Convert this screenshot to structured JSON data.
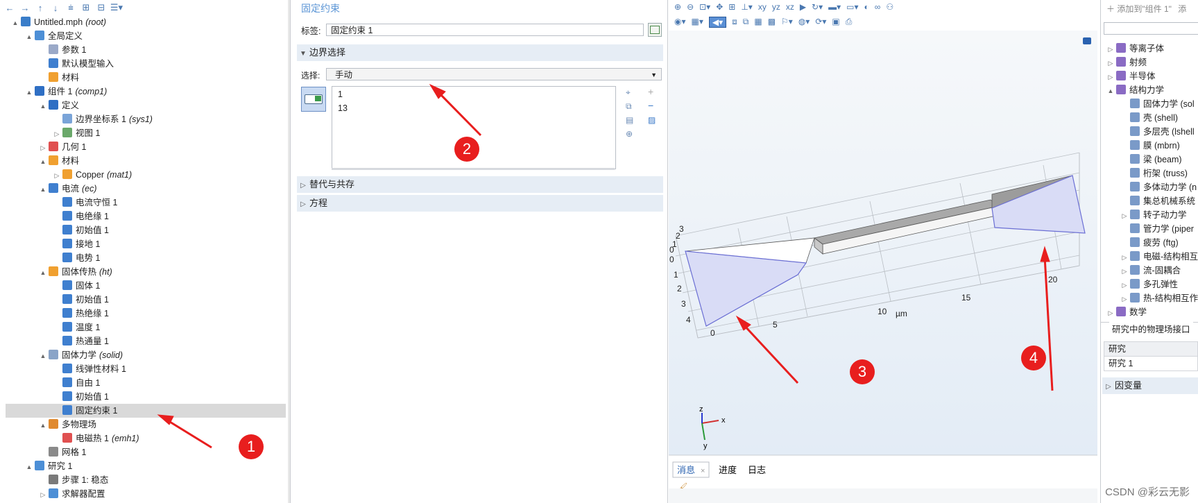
{
  "tree_toolbar": {
    "icons": [
      "back-arrow-icon",
      "forward-arrow-icon",
      "move-up-icon",
      "move-down-icon",
      "show-icon",
      "expand-icon",
      "collapse-icon",
      "list-menu-icon"
    ]
  },
  "tree": {
    "items": [
      {
        "label": "Untitled.mph",
        "tag": "(root)",
        "depth": 0,
        "toggle": "▲",
        "icon": "model-icon",
        "color": "#3a7dc9"
      },
      {
        "label": "全局定义",
        "tag": "",
        "depth": 1,
        "toggle": "▲",
        "icon": "globe-icon",
        "color": "#4d8fd6"
      },
      {
        "label": "参数 1",
        "tag": "",
        "depth": 2,
        "toggle": "",
        "icon": "parameter-icon",
        "color": "#9aa9c8"
      },
      {
        "label": "默认模型输入",
        "tag": "",
        "depth": 2,
        "toggle": "",
        "icon": "model-input-icon",
        "color": "#3f7fcf"
      },
      {
        "label": "材料",
        "tag": "",
        "depth": 2,
        "toggle": "",
        "icon": "material-icon",
        "color": "#f0a030"
      },
      {
        "label": "组件 1",
        "tag": "(comp1)",
        "depth": 1,
        "toggle": "▲",
        "icon": "component-icon",
        "color": "#2f6fc4"
      },
      {
        "label": "定义",
        "tag": "",
        "depth": 2,
        "toggle": "▲",
        "icon": "definitions-icon",
        "color": "#2f6fc4"
      },
      {
        "label": "边界坐标系 1",
        "tag": "(sys1)",
        "depth": 3,
        "toggle": "",
        "icon": "coordinate-system-icon",
        "color": "#7aa4d8"
      },
      {
        "label": "视图 1",
        "tag": "",
        "depth": 3,
        "toggle": "▷",
        "icon": "view-icon",
        "color": "#6aa86a"
      },
      {
        "label": "几何 1",
        "tag": "",
        "depth": 2,
        "toggle": "▷",
        "icon": "geometry-icon",
        "color": "#e05050"
      },
      {
        "label": "材料",
        "tag": "",
        "depth": 2,
        "toggle": "▲",
        "icon": "material-icon",
        "color": "#f0a030"
      },
      {
        "label": "Copper",
        "tag": "(mat1)",
        "depth": 3,
        "toggle": "▷",
        "icon": "material-icon",
        "color": "#f0a030"
      },
      {
        "label": "电流",
        "tag": "(ec)",
        "depth": 2,
        "toggle": "▲",
        "icon": "electric-currents-icon",
        "color": "#3f7fcf"
      },
      {
        "label": "电流守恒 1",
        "tag": "",
        "depth": 3,
        "toggle": "",
        "icon": "node-icon",
        "color": "#3f7fcf"
      },
      {
        "label": "电绝缘 1",
        "tag": "",
        "depth": 3,
        "toggle": "",
        "icon": "node-icon",
        "color": "#3f7fcf"
      },
      {
        "label": "初始值 1",
        "tag": "",
        "depth": 3,
        "toggle": "",
        "icon": "node-icon",
        "color": "#3f7fcf"
      },
      {
        "label": "接地 1",
        "tag": "",
        "depth": 3,
        "toggle": "",
        "icon": "node-icon",
        "color": "#3f7fcf"
      },
      {
        "label": "电势 1",
        "tag": "",
        "depth": 3,
        "toggle": "",
        "icon": "node-icon",
        "color": "#3f7fcf"
      },
      {
        "label": "固体传热",
        "tag": "(ht)",
        "depth": 2,
        "toggle": "▲",
        "icon": "heat-transfer-icon",
        "color": "#f0a030"
      },
      {
        "label": "固体 1",
        "tag": "",
        "depth": 3,
        "toggle": "",
        "icon": "node-icon",
        "color": "#3f7fcf"
      },
      {
        "label": "初始值 1",
        "tag": "",
        "depth": 3,
        "toggle": "",
        "icon": "node-icon",
        "color": "#3f7fcf"
      },
      {
        "label": "热绝缘 1",
        "tag": "",
        "depth": 3,
        "toggle": "",
        "icon": "node-icon",
        "color": "#3f7fcf"
      },
      {
        "label": "温度 1",
        "tag": "",
        "depth": 3,
        "toggle": "",
        "icon": "node-icon",
        "color": "#3f7fcf"
      },
      {
        "label": "热通量 1",
        "tag": "",
        "depth": 3,
        "toggle": "",
        "icon": "node-icon",
        "color": "#3f7fcf"
      },
      {
        "label": "固体力学",
        "tag": "(solid)",
        "depth": 2,
        "toggle": "▲",
        "icon": "solid-mechanics-icon",
        "color": "#8aa4c8"
      },
      {
        "label": "线弹性材料 1",
        "tag": "",
        "depth": 3,
        "toggle": "",
        "icon": "node-icon",
        "color": "#3f7fcf"
      },
      {
        "label": "自由 1",
        "tag": "",
        "depth": 3,
        "toggle": "",
        "icon": "node-icon",
        "color": "#3f7fcf"
      },
      {
        "label": "初始值 1",
        "tag": "",
        "depth": 3,
        "toggle": "",
        "icon": "node-icon",
        "color": "#3f7fcf"
      },
      {
        "label": "固定约束 1",
        "tag": "",
        "depth": 3,
        "toggle": "",
        "icon": "node-icon",
        "color": "#3f7fcf",
        "selected": true
      },
      {
        "label": "多物理场",
        "tag": "",
        "depth": 2,
        "toggle": "▲",
        "icon": "multiphysics-icon",
        "color": "#e08a30"
      },
      {
        "label": "电磁热 1",
        "tag": "(emh1)",
        "depth": 3,
        "toggle": "",
        "icon": "multiphysics-coupling-icon",
        "color": "#e05050"
      },
      {
        "label": "网格 1",
        "tag": "",
        "depth": 2,
        "toggle": "",
        "icon": "mesh-icon",
        "color": "#8a8a8a"
      },
      {
        "label": "研究 1",
        "tag": "",
        "depth": 1,
        "toggle": "▲",
        "icon": "study-icon",
        "color": "#4d8fd6"
      },
      {
        "label": "步骤 1: 稳态",
        "tag": "",
        "depth": 2,
        "toggle": "",
        "icon": "study-step-icon",
        "color": "#7a7a7a"
      },
      {
        "label": "求解器配置",
        "tag": "",
        "depth": 2,
        "toggle": "▷",
        "icon": "solver-icon",
        "color": "#4d8fd6"
      }
    ]
  },
  "settings": {
    "title": "固定约束",
    "label_caption": "标签:",
    "label_value": "固定约束 1",
    "boundary_section": "边界选择",
    "selection_caption": "选择:",
    "selection_value": "手动",
    "selection_items": [
      "1",
      "13"
    ],
    "override_section": "替代与共存",
    "equation_section": "方程"
  },
  "graphics": {
    "axis_unit": "µm",
    "x_ticks": [
      "5",
      "10",
      "15",
      "20"
    ],
    "left_ticks": [
      "3",
      "2",
      "1",
      "0",
      "0",
      "1",
      "2",
      "3",
      "4",
      "0"
    ],
    "triad": {
      "x": "x",
      "y": "y",
      "z": "z"
    },
    "highlight_color": "#d9dcf6"
  },
  "messages": {
    "tabs": [
      "消息",
      "进度",
      "日志"
    ]
  },
  "right_panel": {
    "add_to": "添加到\"组件 1\"",
    "add_more": "添",
    "physics": [
      {
        "label": "等离子体",
        "depth": 0,
        "toggle": "▷"
      },
      {
        "label": "射频",
        "depth": 0,
        "toggle": "▷"
      },
      {
        "label": "半导体",
        "depth": 0,
        "toggle": "▷"
      },
      {
        "label": "结构力学",
        "depth": 0,
        "toggle": "▲"
      },
      {
        "label": "固体力学 (sol",
        "depth": 1,
        "toggle": ""
      },
      {
        "label": "壳 (shell)",
        "depth": 1,
        "toggle": ""
      },
      {
        "label": "多层壳 (lshell",
        "depth": 1,
        "toggle": ""
      },
      {
        "label": "膜 (mbrn)",
        "depth": 1,
        "toggle": ""
      },
      {
        "label": "梁 (beam)",
        "depth": 1,
        "toggle": ""
      },
      {
        "label": "桁架 (truss)",
        "depth": 1,
        "toggle": ""
      },
      {
        "label": "多体动力学 (n",
        "depth": 1,
        "toggle": ""
      },
      {
        "label": "集总机械系统",
        "depth": 1,
        "toggle": ""
      },
      {
        "label": "转子动力学",
        "depth": 1,
        "toggle": "▷"
      },
      {
        "label": "管力学 (piper",
        "depth": 1,
        "toggle": ""
      },
      {
        "label": "疲劳 (ftg)",
        "depth": 1,
        "toggle": ""
      },
      {
        "label": "电磁-结构相互",
        "depth": 1,
        "toggle": "▷"
      },
      {
        "label": "流-固耦合",
        "depth": 1,
        "toggle": "▷"
      },
      {
        "label": "多孔弹性",
        "depth": 1,
        "toggle": "▷"
      },
      {
        "label": "热-结构相互作",
        "depth": 1,
        "toggle": "▷"
      },
      {
        "label": "数学",
        "depth": 0,
        "toggle": "▷"
      }
    ],
    "study_interfaces": "研究中的物理场接口",
    "study_header": "研究",
    "study_row": "研究 1",
    "dependent_vars": "因变量"
  },
  "callouts": [
    "1",
    "2",
    "3",
    "4"
  ],
  "watermark": "CSDN @彩云无影"
}
